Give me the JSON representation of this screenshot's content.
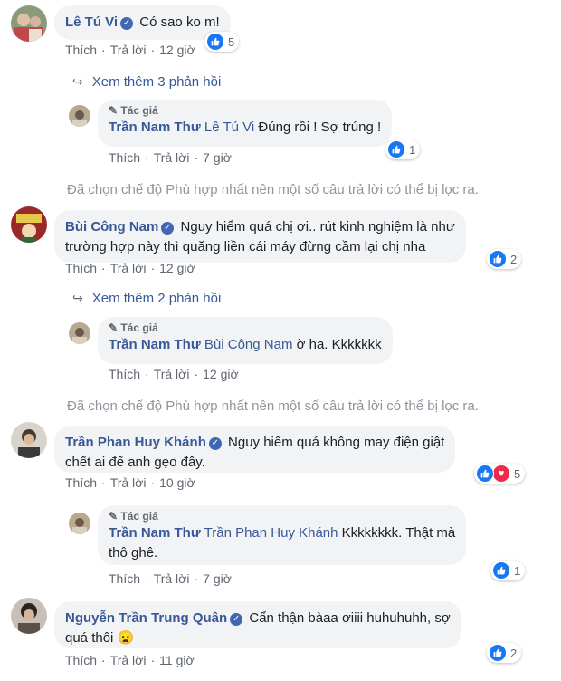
{
  "labels": {
    "like": "Thích",
    "reply": "Trả lời",
    "author_tag": "Tác giả"
  },
  "comments": [
    {
      "name": "Lê Tú Vi",
      "text": "Có sao ko m!",
      "time": "12 giờ",
      "reactions": "5"
    },
    {
      "more": "Xem thêm 3 phản hồi"
    },
    {
      "name": "Trần Nam Thư",
      "mention": "Lê Tú Vi",
      "text": "Đúng rồi ! Sợ trúng !",
      "time": "7 giờ",
      "reactions": "1"
    },
    {
      "filter": "Đã chọn chế độ Phù hợp nhất nên một số câu trả lời có thể bị lọc ra."
    },
    {
      "name": "Bùi Công Nam",
      "text1": "Nguy hiểm quá chị ơi.. rút kinh nghiệm là như",
      "text2": "trường hợp này thì quăng liền cái máy đừng cầm lại chị nha",
      "time": "12 giờ",
      "reactions": "2"
    },
    {
      "more": "Xem thêm 2 phản hồi"
    },
    {
      "name": "Trần Nam Thư",
      "mention": "Bùi Công Nam",
      "text": "ờ ha. Kkkkkkk",
      "time": "12 giờ"
    },
    {
      "filter": "Đã chọn chế độ Phù hợp nhất nên một số câu trả lời có thể bị lọc ra."
    },
    {
      "name": "Trần Phan Huy Khánh",
      "text1": "Nguy hiểm quá không may điện giật",
      "text2": "chết ai để anh gẹo đây.",
      "time": "10 giờ",
      "reactions": "5"
    },
    {
      "name": "Trần Nam Thư",
      "mention": "Trần Phan Huy Khánh",
      "text1": "Kkkkkkkk. Thật mà",
      "text2": "thô ghê.",
      "time": "7 giờ",
      "reactions": "1"
    },
    {
      "name": "Nguyễn Trần Trung Quân",
      "text1": "Cẩn thận bàaa ơiiii huhuhuhh, sợ",
      "text2": "quá thôi 😦",
      "time": "11 giờ",
      "reactions": "2"
    }
  ]
}
